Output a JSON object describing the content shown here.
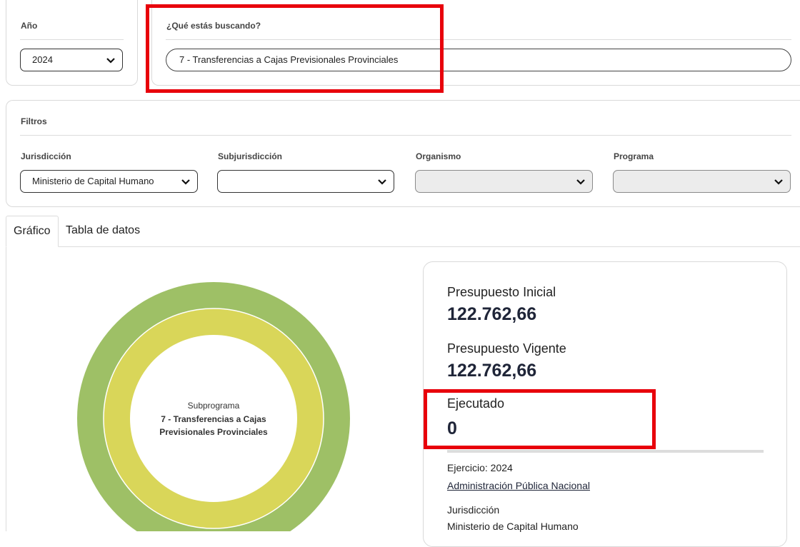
{
  "search_panel": {
    "year_label": "Año",
    "year_value": "2024",
    "search_label": "¿Qué estás buscando?",
    "search_value": "7 - Transferencias a Cajas Previsionales Provinciales"
  },
  "filters": {
    "title": "Filtros",
    "jurisdiccion_label": "Jurisdicción",
    "jurisdiccion_value": "Ministerio de Capital Humano",
    "subjurisdiccion_label": "Subjurisdicción",
    "subjurisdiccion_value": "",
    "organismo_label": "Organismo",
    "organismo_value": "",
    "programa_label": "Programa",
    "programa_value": ""
  },
  "tabs": [
    {
      "label": "Gráfico",
      "active": true
    },
    {
      "label": "Tabla de datos",
      "active": false
    }
  ],
  "donut": {
    "center_caption": "Subprograma",
    "center_title_line1": "7 - Transferencias a Cajas",
    "center_title_line2": "Previsionales Provinciales",
    "outer_color": "#9ec066",
    "inner_color": "#d9d659"
  },
  "summary": {
    "presupuesto_inicial_label": "Presupuesto Inicial",
    "presupuesto_inicial_value": "122.762,66",
    "presupuesto_vigente_label": "Presupuesto Vigente",
    "presupuesto_vigente_value": "122.762,66",
    "ejecutado_label": "Ejecutado",
    "ejecutado_value": "0",
    "ejercicio_text": "Ejercicio: 2024",
    "administracion_link": "Administración Pública Nacional",
    "jurisdiccion_label": "Jurisdicción",
    "jurisdiccion_value": "Ministerio de Capital Humano"
  },
  "colors": {
    "highlight": "#e8000b",
    "value_text": "#1f2538"
  },
  "icons": [
    "chevron-down-icon"
  ]
}
